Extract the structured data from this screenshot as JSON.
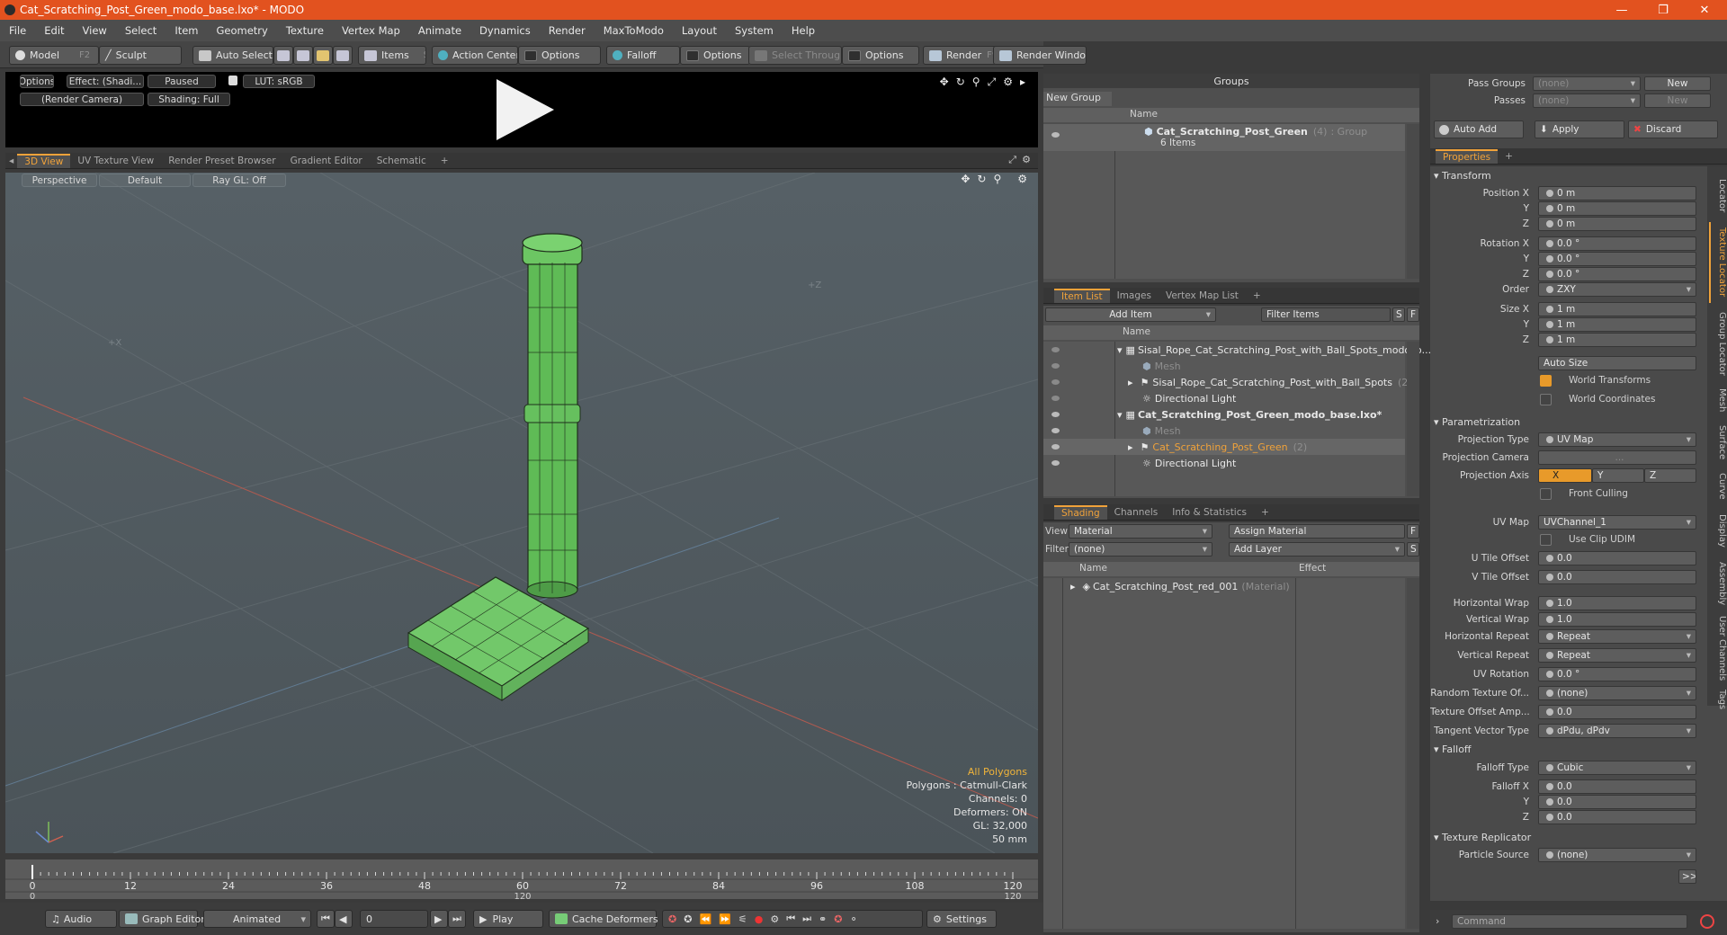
{
  "window": {
    "title": "Cat_Scratching_Post_Green_modo_base.lxo* - MODO"
  },
  "menu": [
    "File",
    "Edit",
    "View",
    "Select",
    "Item",
    "Geometry",
    "Texture",
    "Vertex Map",
    "Animate",
    "Dynamics",
    "Render",
    "MaxToModo",
    "Layout",
    "System",
    "Help"
  ],
  "toolbar": {
    "model": "Model",
    "model_key": "F2",
    "sculpt": "Sculpt",
    "auto_select": "Auto Select",
    "items": "Items",
    "items_key": "S",
    "action_center": "Action Center",
    "options1": "Options",
    "falloff": "Falloff",
    "options2": "Options",
    "select_through": "Select Through",
    "options3": "Options",
    "render": "Render",
    "render_key": "F9",
    "render_window": "Render Window"
  },
  "viewer": {
    "options": "Options",
    "effect": "Effect: (Shadi...",
    "paused": "Paused",
    "lut": "LUT: sRGB",
    "camera": "(Render Camera)",
    "shading": "Shading: Full"
  },
  "view_tabs": [
    "3D View",
    "UV Texture View",
    "Render Preset Browser",
    "Gradient Editor",
    "Schematic",
    "+"
  ],
  "viewport": {
    "perspective": "Perspective",
    "default": "Default",
    "raygl": "Ray GL: Off",
    "axis_x": "+X",
    "axis_z": "+Z",
    "stats": {
      "sel": "All Polygons",
      "polygons": "Polygons : Catmull-Clark",
      "channels": "Channels: 0",
      "deformers": "Deformers: ON",
      "gl": "GL: 32,000",
      "size": "50 mm"
    }
  },
  "timeline": {
    "ticks": [
      "0",
      "12",
      "24",
      "36",
      "48",
      "60",
      "72",
      "84",
      "96",
      "108",
      "120"
    ],
    "sub": [
      "0",
      "120",
      "120"
    ]
  },
  "bottom": {
    "audio": "Audio",
    "graph_editor": "Graph Editor",
    "animated": "Animated",
    "frame": "0",
    "play": "Play",
    "cache": "Cache Deformers",
    "settings": "Settings"
  },
  "groups": {
    "title": "Groups",
    "new_group": "New Group",
    "col_name": "Name",
    "item_name": "Cat_Scratching_Post_Green",
    "item_count": "(4)",
    "item_type": ": Group",
    "item_sub": "6 Items"
  },
  "itemlist": {
    "tabs": [
      "Item List",
      "Images",
      "Vertex Map List",
      "+"
    ],
    "add_item": "Add Item",
    "filter": "Filter Items",
    "s": "S",
    "f": "F",
    "col_name": "Name",
    "rows": [
      {
        "text": "Sisal_Rope_Cat_Scratching_Post_with_Ball_Spots_modo_b...",
        "style": "normal"
      },
      {
        "text": "Mesh",
        "style": "dim"
      },
      {
        "text": "Sisal_Rope_Cat_Scratching_Post_with_Ball_Spots",
        "extra": "(2)",
        "style": "normal"
      },
      {
        "text": "Directional Light",
        "style": "normal"
      },
      {
        "text": "Cat_Scratching_Post_Green_modo_base.lxo*",
        "style": "bold"
      },
      {
        "text": "Mesh",
        "style": "dim"
      },
      {
        "text": "Cat_Scratching_Post_Green",
        "extra": "(2)",
        "style": "orange"
      },
      {
        "text": "Directional Light",
        "style": "normal"
      }
    ]
  },
  "shading": {
    "tabs": [
      "Shading",
      "Channels",
      "Info & Statistics",
      "+"
    ],
    "view_label": "View",
    "view_value": "Material",
    "assign": "Assign Material",
    "f": "F",
    "filter_label": "Filter",
    "filter_value": "(none)",
    "add_layer": "Add Layer",
    "s": "S",
    "col_name": "Name",
    "col_effect": "Effect",
    "row": "Cat_Scratching_Post_red_001",
    "row_type": "(Material)"
  },
  "right": {
    "pass_groups": "Pass Groups",
    "passes": "Passes",
    "none": "(none)",
    "new": "New",
    "auto_add": "Auto Add",
    "apply": "Apply",
    "discard": "Discard",
    "properties": "Properties",
    "transform": "Transform",
    "position_x": "Position X",
    "y": "Y",
    "z": "Z",
    "rotation_x": "Rotation X",
    "order": "Order",
    "size_x": "Size X",
    "pos": [
      "0 m",
      "0 m",
      "0 m"
    ],
    "rot": [
      "0.0 °",
      "0.0 °",
      "0.0 °"
    ],
    "order_val": "ZXY",
    "size": [
      "1 m",
      "1 m",
      "1 m"
    ],
    "auto_size": "Auto Size",
    "world_transforms": "World Transforms",
    "world_coordinates": "World Coordinates",
    "parametrization": "Parametrization",
    "projection_type": "Projection Type",
    "projection_type_val": "UV Map",
    "projection_camera": "Projection Camera",
    "projection_camera_val": "...",
    "projection_axis": "Projection Axis",
    "axis_x": "X",
    "axis_y": "Y",
    "axis_z": "Z",
    "front_culling": "Front Culling",
    "uv_map": "UV Map",
    "uv_map_val": "UVChannel_1",
    "use_clip_udim": "Use Clip UDIM",
    "u_tile": "U Tile Offset",
    "v_tile": "V Tile Offset",
    "tile_val": "0.0",
    "h_wrap": "Horizontal Wrap",
    "v_wrap": "Vertical Wrap",
    "wrap_val": "1.0",
    "h_repeat": "Horizontal Repeat",
    "v_repeat": "Vertical Repeat",
    "repeat_val": "Repeat",
    "uv_rotation": "UV Rotation",
    "uv_rotation_val": "0.0 °",
    "random_tex": "Random Texture Of...",
    "random_tex_val": "(none)",
    "tex_offset": "Texture Offset Amp...",
    "tex_offset_val": "0.0",
    "tangent": "Tangent Vector Type",
    "tangent_val": "dPdu, dPdv",
    "falloff": "Falloff",
    "falloff_type": "Falloff Type",
    "falloff_type_val": "Cubic",
    "falloff_x": "Falloff X",
    "falloff_vals": [
      "0.0",
      "0.0",
      "0.0"
    ],
    "tex_replicator": "Texture Replicator",
    "particle_source": "Particle Source",
    "particle_val": "(none)",
    "more": ">>",
    "command": "Command",
    "vtabs": [
      "Locator",
      "Texture Locator",
      "Group Locator",
      "Mesh",
      "Surface",
      "Curve",
      "Display",
      "Assembly",
      "User Channels",
      "Tags"
    ]
  }
}
